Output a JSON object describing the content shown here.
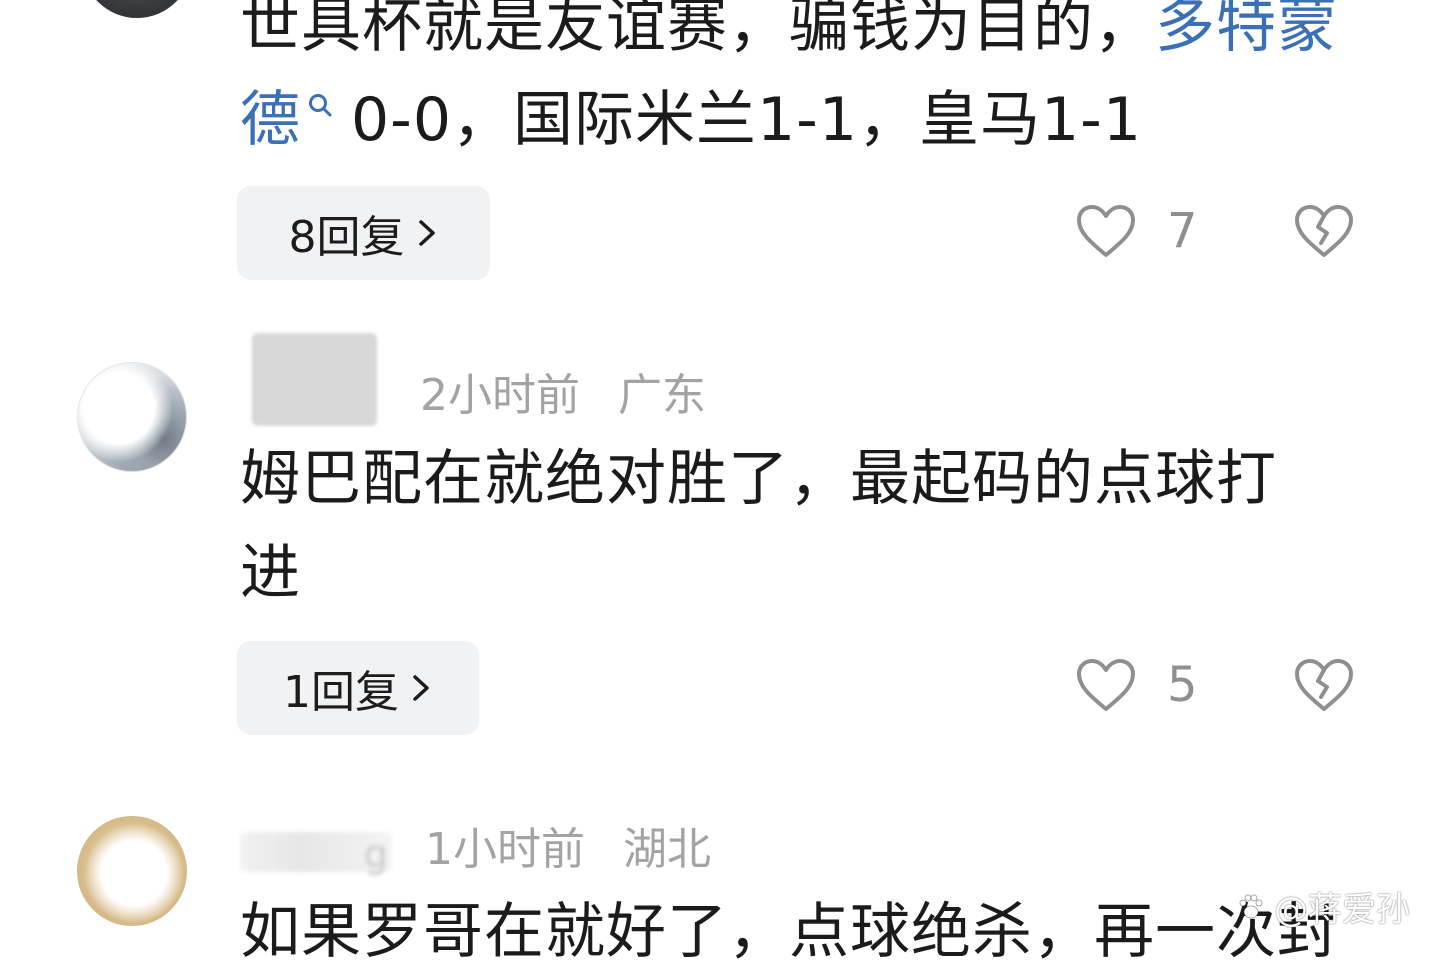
{
  "comments": [
    {
      "text_line1_prefix": "世具杯就是友谊赛，骗钱为目的，",
      "text_line1_link": "多特蒙",
      "text_line2_link": "德",
      "text_line2_rest": "0-0，国际米兰1-1，皇马1-1",
      "reply_label": "8回复",
      "likes": "7"
    },
    {
      "time": "2小时前",
      "location": "广东",
      "text_line1": "姆巴配在就绝对胜了，最起码的点球打",
      "text_line2": "进",
      "reply_label": "1回复",
      "likes": "5"
    },
    {
      "time": "1小时前",
      "location": "湖北",
      "name_fragment": "g",
      "text_line1": "如果罗哥在就好了，点球绝杀，再一次封"
    }
  ],
  "watermark": "@蒋爱孙",
  "colors": {
    "link": "#3b6fb6",
    "meta": "#a3a3a3",
    "reply_bg": "#f1f2f4"
  }
}
